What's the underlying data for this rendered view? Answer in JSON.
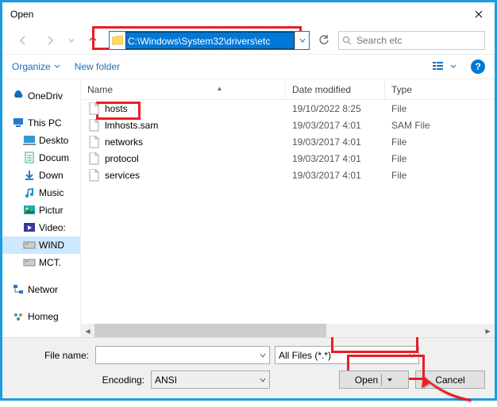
{
  "window": {
    "title": "Open"
  },
  "nav": {
    "path": "C:\\Windows\\System32\\drivers\\etc",
    "search_placeholder": "Search etc"
  },
  "toolbar": {
    "organize": "Organize",
    "newfolder": "New folder"
  },
  "sidebar": {
    "items": [
      {
        "label": "OneDriv",
        "kind": "cloud"
      },
      {
        "label": "This PC",
        "kind": "pc"
      },
      {
        "label": "Deskto",
        "kind": "desktop",
        "indent": true
      },
      {
        "label": "Docum",
        "kind": "docs",
        "indent": true
      },
      {
        "label": "Down",
        "kind": "downloads",
        "indent": true
      },
      {
        "label": "Music",
        "kind": "music",
        "indent": true
      },
      {
        "label": "Pictur",
        "kind": "pictures",
        "indent": true
      },
      {
        "label": "Video:",
        "kind": "videos",
        "indent": true
      },
      {
        "label": "WIND",
        "kind": "disk",
        "indent": true,
        "selected": true
      },
      {
        "label": "MCT.",
        "kind": "disk",
        "indent": true
      },
      {
        "label": "Networ",
        "kind": "network"
      },
      {
        "label": "Homeg",
        "kind": "homegroup"
      }
    ]
  },
  "columns": {
    "name": "Name",
    "date": "Date modified",
    "type": "Type"
  },
  "files": [
    {
      "name": "hosts",
      "date": "19/10/2022 8:25",
      "type": "File"
    },
    {
      "name": "lmhosts.sam",
      "date": "19/03/2017 4:01",
      "type": "SAM File"
    },
    {
      "name": "networks",
      "date": "19/03/2017 4:01",
      "type": "File"
    },
    {
      "name": "protocol",
      "date": "19/03/2017 4:01",
      "type": "File"
    },
    {
      "name": "services",
      "date": "19/03/2017 4:01",
      "type": "File"
    }
  ],
  "bottom": {
    "filename_label": "File name:",
    "filename_value": "",
    "encoding_label": "Encoding:",
    "encoding_value": "ANSI",
    "filter_value": "All Files  (*.*)",
    "open_label": "Open",
    "cancel_label": "Cancel"
  }
}
